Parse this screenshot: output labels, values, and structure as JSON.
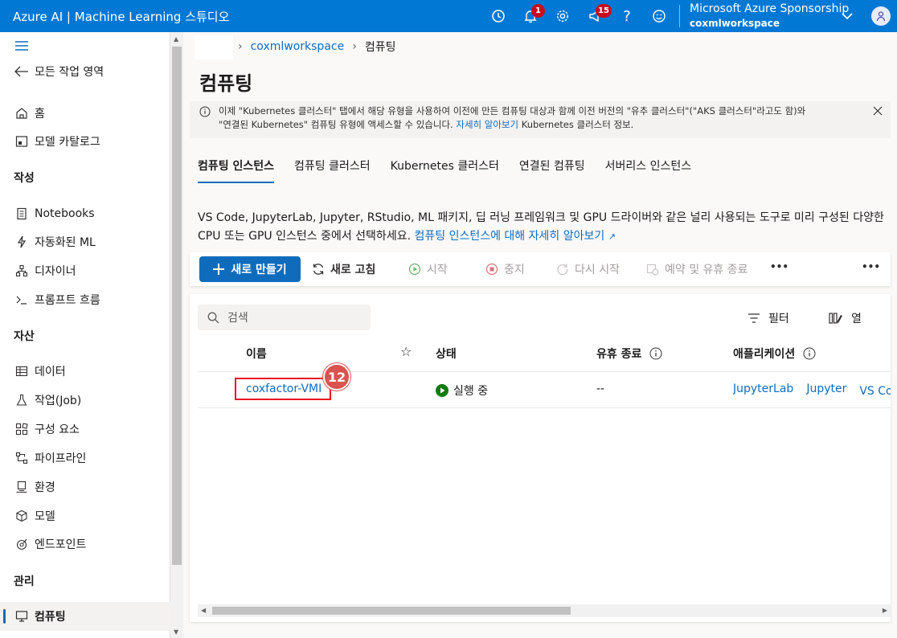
{
  "app_title": "Azure AI | Machine Learning 스튜디오",
  "topbar": {
    "icons": [
      "clock-icon",
      "bell-icon",
      "gear-icon",
      "megaphone-icon",
      "help-icon",
      "smiley-icon"
    ],
    "notif_count": "1",
    "announce_count": "15",
    "account_name": "Microsoft Azure Sponsorship",
    "workspace": "coxmlworkspace"
  },
  "sidebar": {
    "back_label": "모든 작업 영역",
    "home": "홈",
    "model_catalog": "모델 카탈로그",
    "section_author": "작성",
    "notebooks": "Notebooks",
    "automl": "자동화된 ML",
    "designer": "디자이너",
    "promptflow": "프롬프트 흐름",
    "section_assets": "자산",
    "data": "데이터",
    "jobs": "작업(Job)",
    "components": "구성 요소",
    "pipelines": "파이프라인",
    "environments": "환경",
    "models": "모델",
    "endpoints": "엔드포인트",
    "section_manage": "관리",
    "compute": "컴퓨팅"
  },
  "breadcrumb": {
    "workspace": "coxmlworkspace",
    "current": "컴퓨팅"
  },
  "page_title": "컴퓨팅",
  "info": {
    "text1": "이제 \"Kubernetes 클러스터\" 탭에서 해당 유형을 사용하여 이전에 만든 컴퓨팅 대상과 함께 이전 버전의 \"유추 클러스터\"(\"AKS 클러스터\"라고도 함)와",
    "text2": "\"연결된 Kubernetes\" 컴퓨팅 유형에 액세스할 수 있습니다.",
    "link": "자세히 알아보기",
    "text3": "Kubernetes 클러스터 정보."
  },
  "tabs": [
    "컴퓨팅 인스턴스",
    "컴퓨팅 클러스터",
    "Kubernetes 클러스터",
    "연결된 컴퓨팅",
    "서버리스 인스턴스"
  ],
  "description": {
    "line1": "VS Code, JupyterLab, Jupyter, RStudio, ML 패키지, 딥 러닝 프레임워크 및 GPU 드라이버와 같은 널리 사용되는 도구로 미리 구성된 다양한",
    "line2": "CPU 또는 GPU 인스턴스 중에서 선택하세요.",
    "link": "컴퓨팅 인스턴스에 대해 자세히 알아보기"
  },
  "toolbar": {
    "new": "새로 만들기",
    "refresh": "새로 고침",
    "start": "시작",
    "stop": "중지",
    "restart": "다시 시작",
    "schedule": "예약 및 유휴 종료",
    "more": "•••"
  },
  "grid": {
    "search_placeholder": "검색",
    "filter": "필터",
    "columns": "열",
    "headers": {
      "name": "이름",
      "state": "상태",
      "idle": "유휴 종료",
      "apps": "애플리케이션"
    },
    "rows": [
      {
        "name": "coxfactor-VMI",
        "state": "실행 중",
        "idle": "--",
        "apps": [
          "JupyterLab",
          "Jupyter",
          "VS Code(웹)"
        ]
      }
    ]
  },
  "step_badge": "12",
  "colors": {
    "brand": "#0078d4",
    "primary": "#0f6cbd",
    "running": "#107c10",
    "highlight": "#e81123",
    "step": "#d9534f"
  }
}
